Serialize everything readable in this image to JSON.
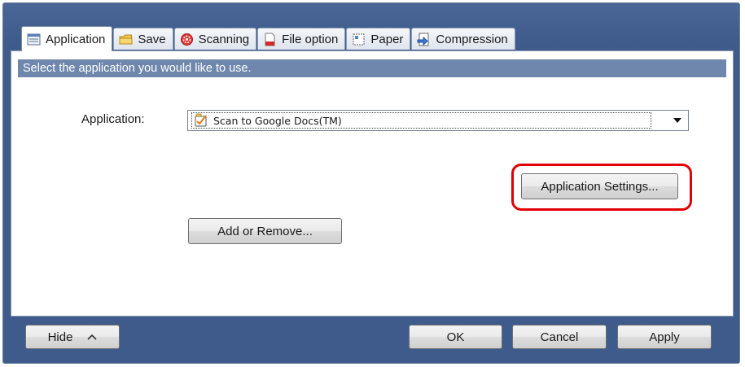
{
  "tabs": [
    {
      "label": "Application",
      "icon": "application-icon",
      "active": true
    },
    {
      "label": "Save",
      "icon": "save-folder-icon",
      "active": false
    },
    {
      "label": "Scanning",
      "icon": "scanning-icon",
      "active": false
    },
    {
      "label": "File option",
      "icon": "file-option-icon",
      "active": false
    },
    {
      "label": "Paper",
      "icon": "paper-icon",
      "active": false
    },
    {
      "label": "Compression",
      "icon": "compression-icon",
      "active": false
    }
  ],
  "banner": "Select the application you would like to use.",
  "application": {
    "label": "Application:",
    "selected": "Scan to Google Docs(TM)"
  },
  "buttons": {
    "app_settings": "Application Settings...",
    "add_remove": "Add or Remove...",
    "hide": "Hide",
    "ok": "OK",
    "cancel": "Cancel",
    "apply": "Apply"
  },
  "colors": {
    "window_frame": "#3e5b8c",
    "banner": "#6f87ad",
    "highlight": "#e00000"
  }
}
